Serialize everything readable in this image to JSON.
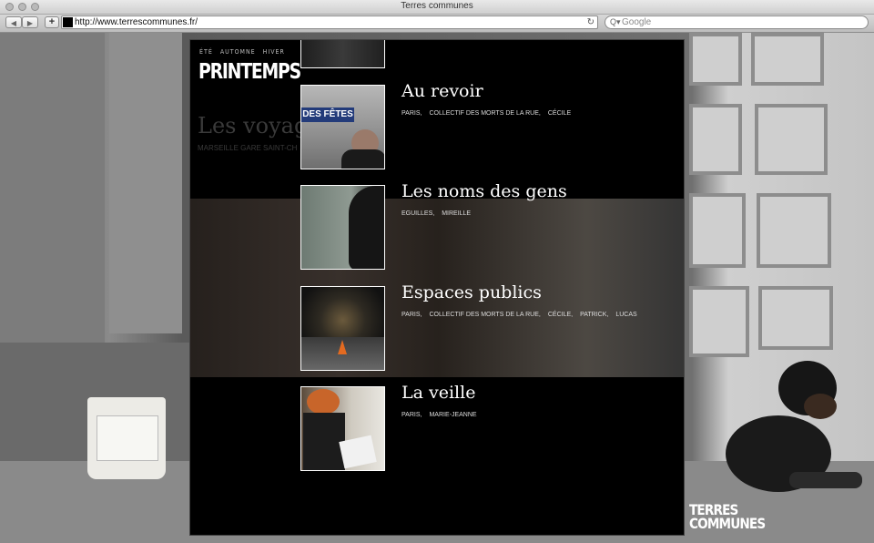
{
  "window": {
    "title": "Terres communes"
  },
  "toolbar": {
    "url": "http://www.terrescommunes.fr/",
    "search_placeholder": "Google",
    "back_icon": "back-arrow-icon",
    "forward_icon": "forward-arrow-icon",
    "reload_icon": "reload-icon"
  },
  "season_nav": {
    "items": [
      "ÉTÉ",
      "AUTOMNE",
      "HIVER"
    ],
    "current": "PRINTEMPS"
  },
  "ghost": {
    "title": "Les voyage",
    "subtitle": "MARSEILLE GARE SAINT-CH"
  },
  "entries": [
    {
      "title": "Au revoir",
      "tags": [
        "PARIS,",
        "COLLECTIF DES MORTS DE LA RUE,",
        "CÉCILE"
      ],
      "thumb_sign": "DES FÊTES"
    },
    {
      "title": "Les noms des gens",
      "tags": [
        "EGUILLES,",
        "MIREILLE"
      ]
    },
    {
      "title": "Espaces publics",
      "tags": [
        "PARIS,",
        "COLLECTIF DES MORTS DE LA RUE,",
        "CÉCILE,",
        "PATRICK,",
        "LUCAS"
      ]
    },
    {
      "title": "La veille",
      "tags": [
        "PARIS,",
        "MARIE-JEANNE"
      ]
    }
  ],
  "logo": {
    "line1": "TERRES",
    "line2": "COMMUNES"
  },
  "colors": {
    "panel": "#000000",
    "text": "#ffffff",
    "chrome": "#d0d0d0"
  }
}
